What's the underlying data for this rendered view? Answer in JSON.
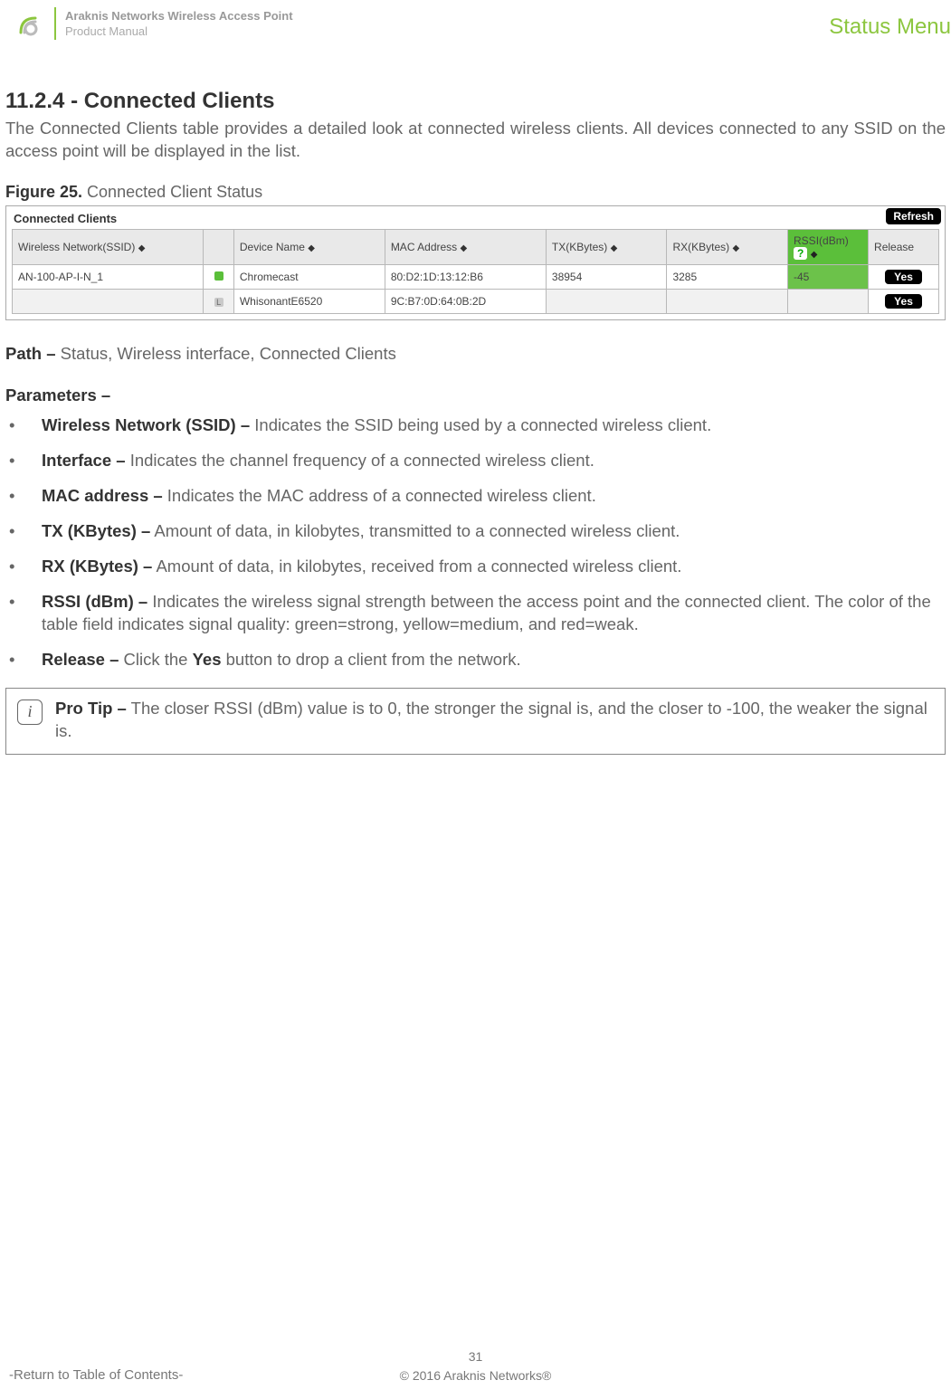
{
  "header": {
    "title_main": "Araknis Networks Wireless Access Point",
    "title_sub": "Product Manual",
    "menu_label": "Status Menu"
  },
  "section": {
    "number_title": "11.2.4 - Connected Clients",
    "lead": "The Connected Clients table provides a detailed look at connected wireless clients. All devices connected to any SSID on the access point will be displayed in the list."
  },
  "figure": {
    "label": "Figure 25.",
    "caption": "Connected Client Status",
    "panel_title": "Connected Clients",
    "refresh_label": "Refresh",
    "columns": {
      "ssid": "Wireless Network(SSID)",
      "device": "Device Name",
      "mac": "MAC Address",
      "tx": "TX(KBytes)",
      "rx": "RX(KBytes)",
      "rssi": "RSSI(dBm)",
      "release": "Release"
    },
    "help_icon": "?",
    "rows": [
      {
        "ssid": "AN-100-AP-I-N_1",
        "iface_color": "green",
        "device": "Chromecast",
        "mac": "80:D2:1D:13:12:B6",
        "tx": "38954",
        "rx": "3285",
        "rssi": "-45",
        "release": "Yes"
      },
      {
        "ssid": "",
        "iface_color": "grey",
        "iface_glyph": "L",
        "device": "WhisonantE6520",
        "mac": "9C:B7:0D:64:0B:2D",
        "tx": "",
        "rx": "",
        "rssi": "",
        "release": "Yes"
      }
    ]
  },
  "path": {
    "label": "Path –",
    "value": "Status, Wireless interface, Connected Clients"
  },
  "parameters": {
    "heading": "Parameters –",
    "items": [
      {
        "term": "Wireless Network (SSID) –",
        "desc": "Indicates the SSID being used by a connected wireless client."
      },
      {
        "term": "Interface –",
        "desc": "Indicates the channel frequency of a connected wireless client."
      },
      {
        "term": "MAC address –",
        "desc": "Indicates the MAC address of a connected wireless client."
      },
      {
        "term": "TX (KBytes) –",
        "desc": "Amount of data, in kilobytes, transmitted to a connected wireless client."
      },
      {
        "term": "RX (KBytes) –",
        "desc": "Amount of data, in kilobytes, received from a connected wireless client."
      },
      {
        "term": "RSSI (dBm) –",
        "desc": "Indicates the wireless signal strength between the access point and the connected client. The color of the table field indicates signal quality: green=strong, yellow=medium, and red=weak."
      },
      {
        "term": "Release –",
        "desc_pre": "Click the ",
        "desc_bold": "Yes",
        "desc_post": " button to drop a client from the network."
      }
    ]
  },
  "tip": {
    "icon_glyph": "i",
    "label": "Pro Tip –",
    "text": "The closer RSSI (dBm) value is to 0, the stronger the signal is, and the closer to -100, the weaker the signal is."
  },
  "footer": {
    "page": "31",
    "toc": "-Return to Table of Contents-",
    "copyright": "© 2016 Araknis Networks®"
  }
}
